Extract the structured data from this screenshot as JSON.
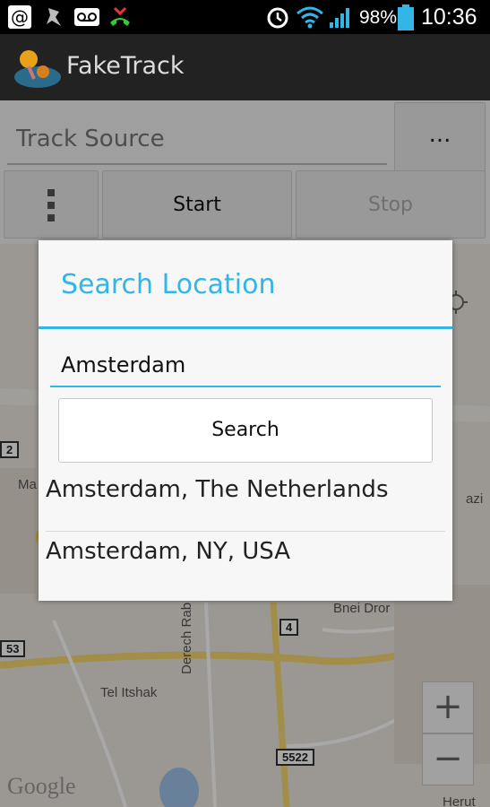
{
  "status_bar": {
    "battery": "98%",
    "time": "10:36",
    "icons": [
      "at-sign-icon",
      "usb-debug-icon",
      "voicemail-icon",
      "missed-call-icon",
      "alarm-icon",
      "wifi-icon",
      "signal-icon",
      "battery-icon"
    ]
  },
  "app": {
    "title": "FakeTrack",
    "logo": "fake-track-logo"
  },
  "controls": {
    "track_source_placeholder": "Track Source",
    "browse_label": "...",
    "menu_icon": "vertical-dots-icon",
    "start_label": "Start",
    "stop_label": "Stop"
  },
  "map": {
    "labels": [
      "Ma",
      "azi",
      "Bnei Dror",
      "Derech Rab",
      "Tel Itshak",
      "Herut"
    ],
    "road_numbers": [
      "2",
      "53",
      "4",
      "5522"
    ],
    "watermark": "Google",
    "zoom_in": "+",
    "zoom_out": "−"
  },
  "dialog": {
    "title": "Search Location",
    "search_value": "Amsterdam",
    "search_button": "Search",
    "results": [
      "Amsterdam, The Netherlands",
      "Amsterdam, NY, USA"
    ]
  },
  "colors": {
    "accent": "#33b5e5",
    "status_bar": "#000000",
    "action_bar": "#222222"
  }
}
